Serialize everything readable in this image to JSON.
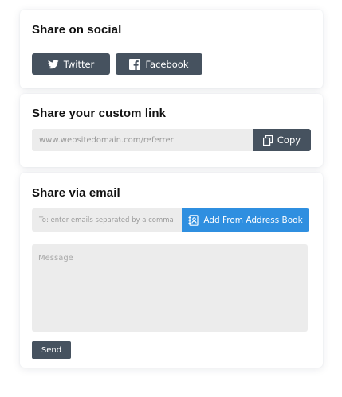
{
  "social": {
    "title": "Share on social",
    "twitter_label": "Twitter",
    "facebook_label": "Facebook"
  },
  "custom_link": {
    "title": "Share your custom link",
    "link_value": "www.websitedomain.com/referrer",
    "copy_label": "Copy"
  },
  "email": {
    "title": "Share via email",
    "to_placeholder": "To: enter emails separated by a comma",
    "address_book_label": "Add From Address Book",
    "message_placeholder": "Message",
    "send_label": "Send"
  },
  "colors": {
    "dark_button": "#46525f",
    "accent_blue": "#2f8fe0",
    "input_bg": "#ececec"
  },
  "icons": [
    "twitter-icon",
    "facebook-icon",
    "copy-icon",
    "address-book-icon"
  ]
}
